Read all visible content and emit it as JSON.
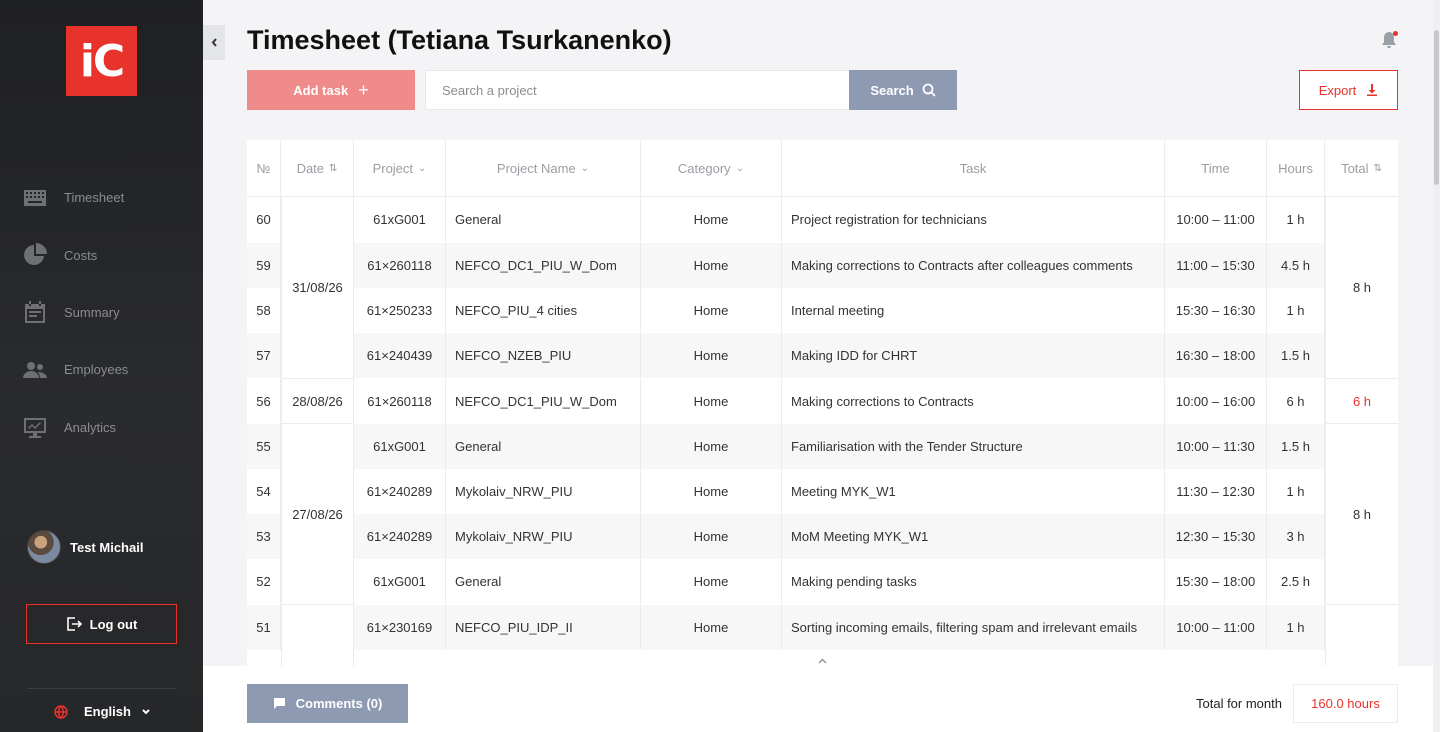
{
  "brand": {
    "logo_text": "iC",
    "accent": "#e8322c"
  },
  "sidebar": {
    "items": [
      {
        "label": "Timesheet",
        "icon": "keyboard-icon"
      },
      {
        "label": "Costs",
        "icon": "pie-chart-icon"
      },
      {
        "label": "Summary",
        "icon": "calendar-icon"
      },
      {
        "label": "Employees",
        "icon": "users-icon"
      },
      {
        "label": "Analytics",
        "icon": "monitor-chart-icon"
      }
    ],
    "user_name": "Test Michail",
    "logout_label": "Log out",
    "language": "English"
  },
  "header": {
    "title": "Timesheet (Tetiana Tsurkanenko)"
  },
  "toolbar": {
    "add_task_label": "Add task",
    "search_placeholder": "Search a project",
    "search_label": "Search",
    "export_label": "Export"
  },
  "table": {
    "columns": [
      "№",
      "Date",
      "Project",
      "Project Name",
      "Category",
      "Task",
      "Time",
      "Hours",
      "Total"
    ],
    "rows": [
      {
        "num": "60",
        "project": "61xG001",
        "name": "General",
        "category": "Home",
        "task": "Project registration for technicians",
        "time": "10:00 – 11:00",
        "hours": "1 h"
      },
      {
        "num": "59",
        "project": "61×260118",
        "name": "NEFCO_DC1_PIU_W_Dom",
        "category": "Home",
        "task": "Making corrections to Contracts after colleagues comments",
        "time": "11:00 – 15:30",
        "hours": "4.5 h"
      },
      {
        "num": "58",
        "project": "61×250233",
        "name": "NEFCO_PIU_4 cities",
        "category": "Home",
        "task": "Internal meeting",
        "time": "15:30 – 16:30",
        "hours": "1 h"
      },
      {
        "num": "57",
        "project": "61×240439",
        "name": "NEFCO_NZEB_PIU",
        "category": "Home",
        "task": "Making IDD for CHRT",
        "time": "16:30 – 18:00",
        "hours": "1.5 h"
      },
      {
        "num": "56",
        "project": "61×260118",
        "name": "NEFCO_DC1_PIU_W_Dom",
        "category": "Home",
        "task": "Making corrections to Contracts",
        "time": "10:00 – 16:00",
        "hours": "6 h"
      },
      {
        "num": "55",
        "project": "61xG001",
        "name": "General",
        "category": "Home",
        "task": "Familiarisation with the Tender Structure",
        "time": "10:00 – 11:30",
        "hours": "1.5 h"
      },
      {
        "num": "54",
        "project": "61×240289",
        "name": "Mykolaiv_NRW_PIU",
        "category": "Home",
        "task": "Meeting MYK_W1",
        "time": "11:30 – 12:30",
        "hours": "1 h"
      },
      {
        "num": "53",
        "project": "61×240289",
        "name": "Mykolaiv_NRW_PIU",
        "category": "Home",
        "task": "MoM Meeting MYK_W1",
        "time": "12:30 – 15:30",
        "hours": "3 h"
      },
      {
        "num": "52",
        "project": "61xG001",
        "name": "General",
        "category": "Home",
        "task": "Making pending tasks",
        "time": "15:30 – 18:00",
        "hours": "2.5 h"
      },
      {
        "num": "51",
        "project": "61×230169",
        "name": "NEFCO_PIU_IDP_II",
        "category": "Home",
        "task": "Sorting incoming emails, filtering spam and irrelevant emails",
        "time": "10:00 – 11:00",
        "hours": "1 h"
      }
    ],
    "groups": [
      {
        "date": "31/08/26",
        "total": "8 h",
        "total_red": false
      },
      {
        "date": "28/08/26",
        "total": "6 h",
        "total_red": true
      },
      {
        "date": "27/08/26",
        "total": "8 h",
        "total_red": false
      }
    ]
  },
  "footer": {
    "comments_label": "Comments (0)",
    "total_label": "Total for month",
    "total_value": "160.0 hours"
  }
}
